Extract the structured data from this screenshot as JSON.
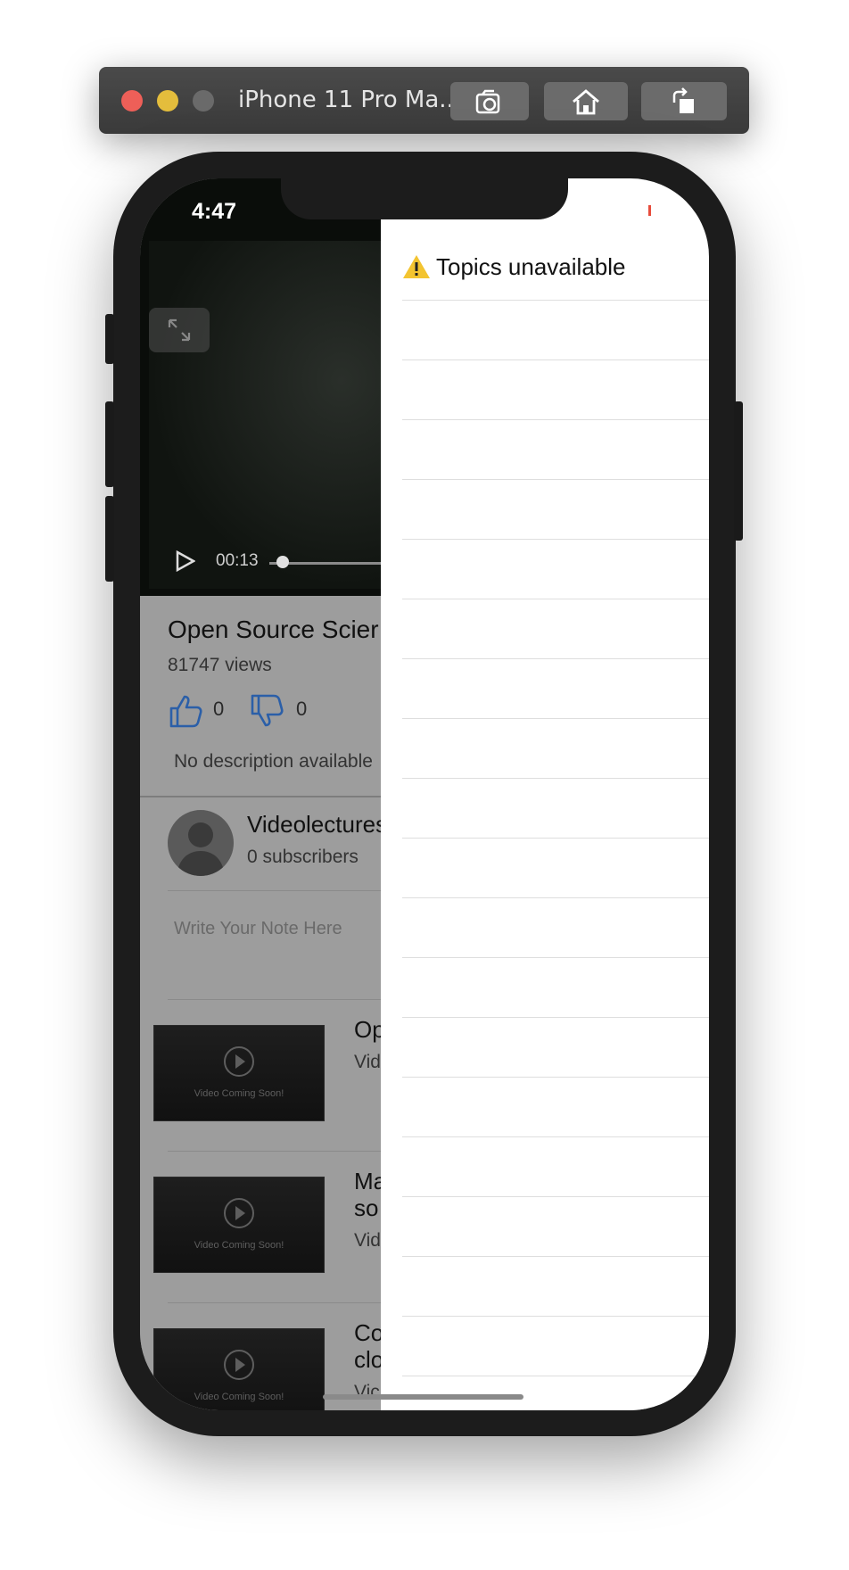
{
  "simulator": {
    "title": "iPhone 11 Pro Ma...",
    "buttons": [
      "screenshot",
      "home",
      "rotate"
    ]
  },
  "status_bar": {
    "time": "4:47"
  },
  "video": {
    "current_time": "00:13"
  },
  "video_info": {
    "title": "Open Source Scier",
    "views": "81747 views",
    "likes": "0",
    "dislikes": "0",
    "description": "No description available"
  },
  "channel": {
    "name": "Videolectures",
    "subscribers": "0 subscribers"
  },
  "note": {
    "placeholder": "Write Your Note Here"
  },
  "related": [
    {
      "title": "Op",
      "subtitle": "Vid",
      "thumb_text": "Video Coming Soon!"
    },
    {
      "title": "Ma\nso",
      "subtitle": "Vid",
      "thumb_text": "Video Coming Soon!"
    },
    {
      "title": "Co\nclo",
      "subtitle": "Vic",
      "thumb_text": "Video Coming Soon!"
    }
  ],
  "drawer": {
    "title": "Topics unavailable",
    "warning_icon": "warning-icon"
  }
}
